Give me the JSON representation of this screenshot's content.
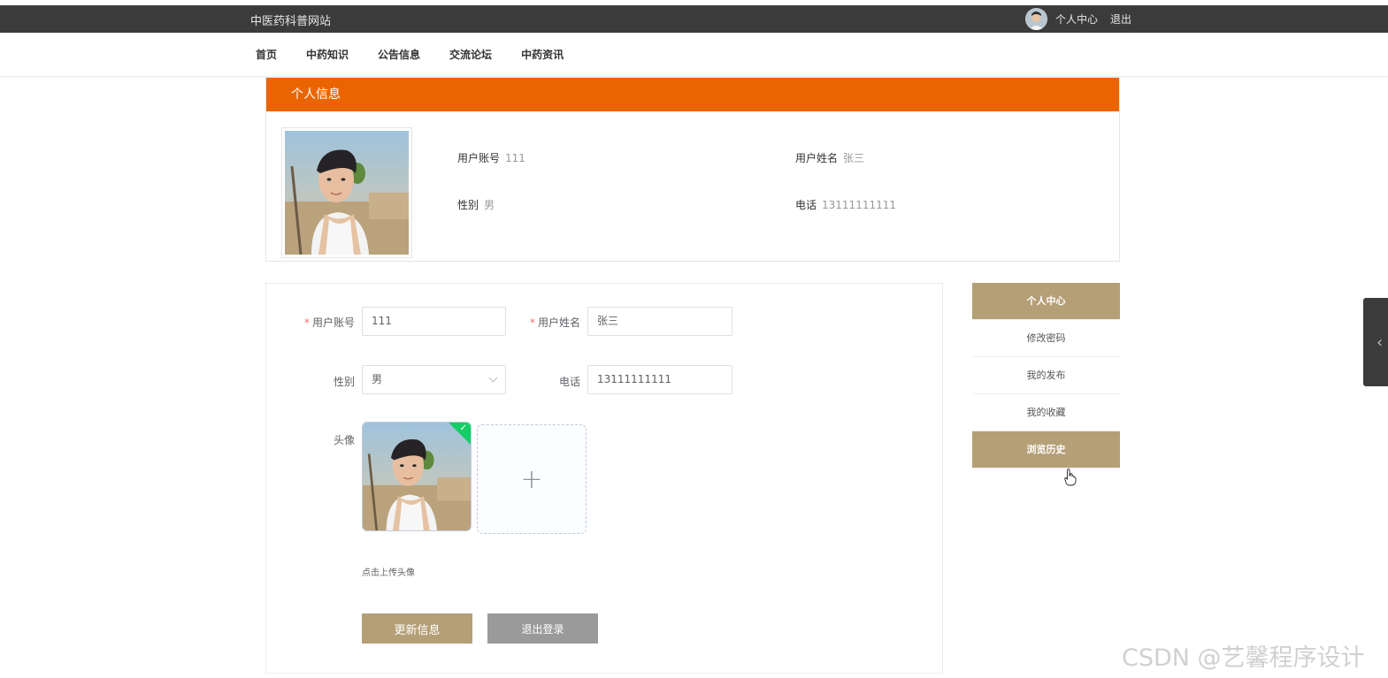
{
  "header": {
    "site_title": "中医药科普网站",
    "user_center": "个人中心",
    "logout": "退出"
  },
  "nav": {
    "items": [
      "首页",
      "中药知识",
      "公告信息",
      "交流论坛",
      "中药资讯"
    ]
  },
  "profile_card": {
    "title": "个人信息",
    "account_label": "用户账号",
    "account_value": "111",
    "name_label": "用户姓名",
    "name_value": "张三",
    "gender_label": "性别",
    "gender_value": "男",
    "phone_label": "电话",
    "phone_value": "13111111111"
  },
  "form": {
    "account_label": "用户账号",
    "account_value": "111",
    "name_label": "用户姓名",
    "name_value": "张三",
    "gender_label": "性别",
    "gender_value": "男",
    "phone_label": "电话",
    "phone_value": "13111111111",
    "avatar_label": "头像",
    "upload_plus": "+",
    "upload_tip": "点击上传头像",
    "update_button": "更新信息",
    "logout_button": "退出登录"
  },
  "side_menu": {
    "items": [
      "个人中心",
      "修改密码",
      "我的发布",
      "我的收藏",
      "浏览历史"
    ]
  },
  "watermark": "CSDN @艺馨程序设计",
  "colors": {
    "topbar": "#3c3b3c",
    "accent_orange": "#ea6502",
    "accent_tan": "#b59f77",
    "secondary_button": "#9a9a9a"
  }
}
